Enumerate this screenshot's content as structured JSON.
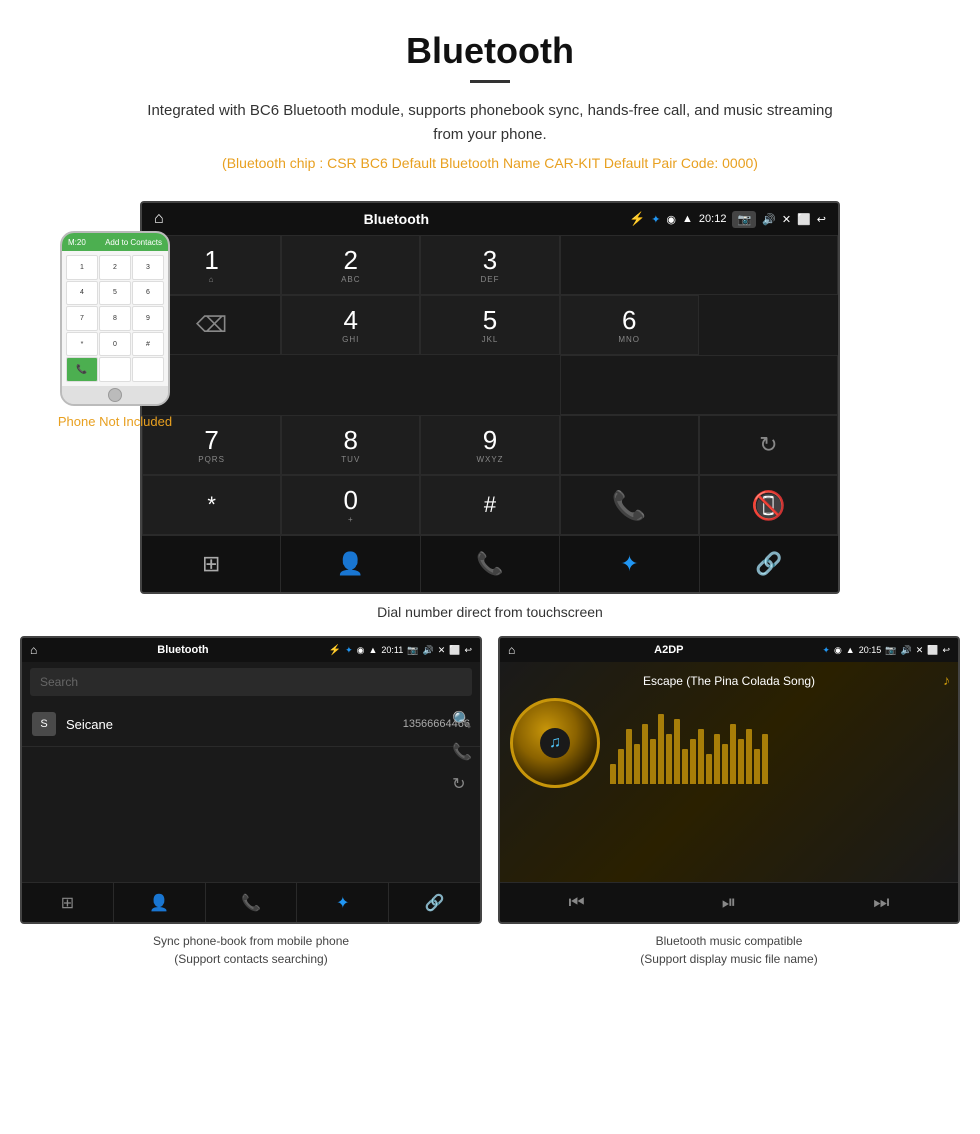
{
  "header": {
    "title": "Bluetooth",
    "description": "Integrated with BC6 Bluetooth module, supports phonebook sync, hands-free call, and music streaming from your phone.",
    "specs": "(Bluetooth chip : CSR BC6   Default Bluetooth Name CAR-KIT    Default Pair Code: 0000)"
  },
  "large_screen": {
    "status_bar": {
      "app_name": "Bluetooth",
      "time": "20:12",
      "usb_icon": "⚡",
      "bt_icon": "✦",
      "location_icon": "◉",
      "signal_icon": "▲",
      "camera_label": "📷",
      "volume_icon": "🔊",
      "close_icon": "✕",
      "window_icon": "⬜",
      "back_icon": "↩"
    },
    "dialpad": {
      "keys": [
        {
          "num": "1",
          "sub": "⌂"
        },
        {
          "num": "2",
          "sub": "ABC"
        },
        {
          "num": "3",
          "sub": "DEF"
        },
        {
          "num": "4",
          "sub": "GHI"
        },
        {
          "num": "5",
          "sub": "JKL"
        },
        {
          "num": "6",
          "sub": "MNO"
        },
        {
          "num": "7",
          "sub": "PQRS"
        },
        {
          "num": "8",
          "sub": "TUV"
        },
        {
          "num": "9",
          "sub": "WXYZ"
        },
        {
          "num": "*",
          "sub": ""
        },
        {
          "num": "0",
          "sub": "+"
        },
        {
          "num": "#",
          "sub": ""
        }
      ]
    },
    "caption": "Dial number direct from touchscreen"
  },
  "phone_aside": {
    "not_included_label": "Phone Not Included"
  },
  "bottom_left": {
    "status_bar": {
      "app_name": "Bluetooth",
      "time": "20:11"
    },
    "search_placeholder": "Search",
    "contacts": [
      {
        "initial": "S",
        "name": "Seicane",
        "number": "13566664466"
      }
    ],
    "caption_line1": "Sync phone-book from mobile phone",
    "caption_line2": "(Support contacts searching)"
  },
  "bottom_right": {
    "status_bar": {
      "app_name": "A2DP",
      "time": "20:15"
    },
    "song_title": "Escape (The Pina Colada Song)",
    "eq_bars": [
      20,
      35,
      55,
      40,
      60,
      45,
      70,
      50,
      65,
      35,
      45,
      55,
      30,
      50,
      40,
      60,
      45,
      55,
      35,
      50
    ],
    "caption_line1": "Bluetooth music compatible",
    "caption_line2": "(Support display music file name)"
  },
  "watermark": "Seicane",
  "bottom_actions": {
    "dialpad_icon": "⊞",
    "contact_icon": "👤",
    "phone_icon": "📞",
    "bt_icon": "✦",
    "link_icon": "🔗"
  }
}
